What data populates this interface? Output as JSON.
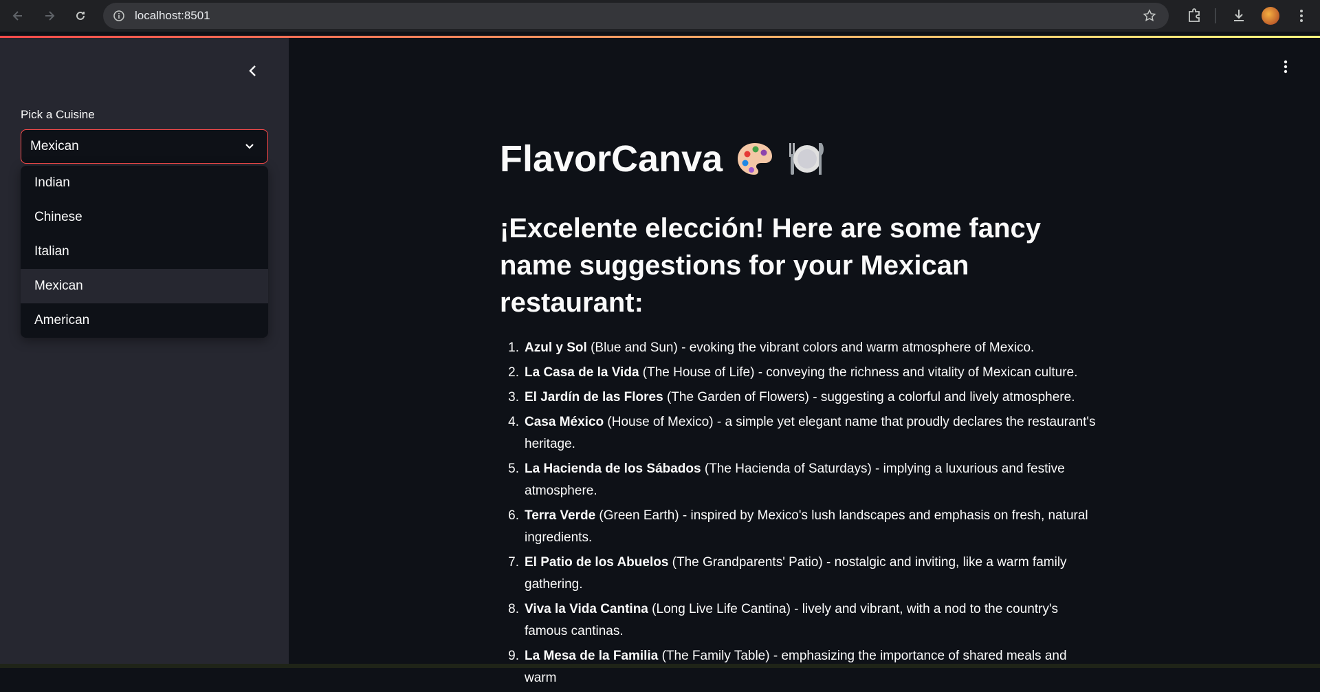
{
  "browser": {
    "url": "localhost:8501"
  },
  "sidebar": {
    "select_label": "Pick a Cuisine",
    "selected_value": "Mexican",
    "options": [
      "Indian",
      "Chinese",
      "Italian",
      "Mexican",
      "American"
    ]
  },
  "main": {
    "title": "FlavorCanva",
    "heading": "¡Excelente elección! Here are some fancy name suggestions for your Mexican restaurant:",
    "items": [
      {
        "num": "1.",
        "name": "Azul y Sol",
        "desc": " (Blue and Sun) - evoking the vibrant colors and warm atmosphere of Mexico."
      },
      {
        "num": "2.",
        "name": "La Casa de la Vida",
        "desc": " (The House of Life) - conveying the richness and vitality of Mexican culture."
      },
      {
        "num": "3.",
        "name": "El Jardín de las Flores",
        "desc": " (The Garden of Flowers) - suggesting a colorful and lively atmosphere."
      },
      {
        "num": "4.",
        "name": "Casa México",
        "desc": " (House of Mexico) - a simple yet elegant name that proudly declares the restaurant's heritage."
      },
      {
        "num": "5.",
        "name": "La Hacienda de los Sábados",
        "desc": " (The Hacienda of Saturdays) - implying a luxurious and festive atmosphere."
      },
      {
        "num": "6.",
        "name": "Terra Verde",
        "desc": " (Green Earth) - inspired by Mexico's lush landscapes and emphasis on fresh, natural ingredients."
      },
      {
        "num": "7.",
        "name": "El Patio de los Abuelos",
        "desc": " (The Grandparents' Patio) - nostalgic and inviting, like a warm family gathering."
      },
      {
        "num": "8.",
        "name": "Viva la Vida Cantina",
        "desc": " (Long Live Life Cantina) - lively and vibrant, with a nod to the country's famous cantinas."
      },
      {
        "num": "9.",
        "name": "La Mesa de la Familia",
        "desc": " (The Family Table) - emphasizing the importance of shared meals and warm"
      }
    ]
  },
  "colors": {
    "accent": "#ff4b4b",
    "sidebar_bg": "#262730",
    "main_bg": "#0e1117"
  },
  "icons": [
    "back-arrow-icon",
    "forward-arrow-icon",
    "reload-icon",
    "site-info-icon",
    "star-icon",
    "extensions-icon",
    "download-icon",
    "profile-avatar",
    "chrome-menu-icon",
    "collapse-sidebar-icon",
    "chevron-down-icon",
    "kebab-menu-icon",
    "artist-palette-icon",
    "plate-cutlery-icon"
  ]
}
